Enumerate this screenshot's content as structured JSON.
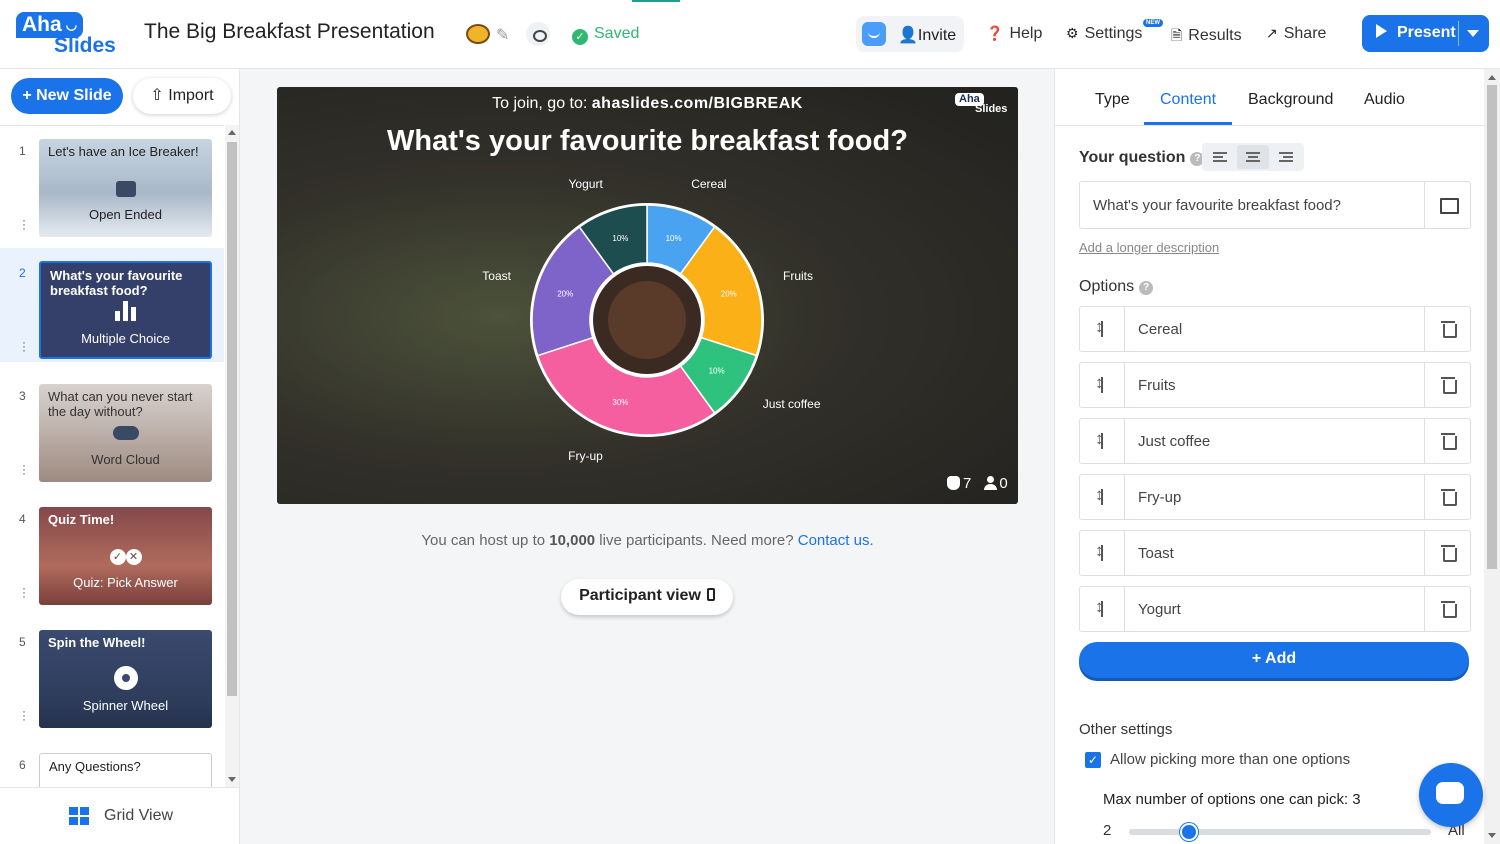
{
  "app": {
    "logo_top": "Aha",
    "logo_bottom": "Slides",
    "title": "The Big Breakfast Presentation",
    "status": "Saved"
  },
  "topnav": {
    "invite": "Invite",
    "help": "Help",
    "settings": "Settings",
    "settings_badge": "NEW",
    "results": "Results",
    "share": "Share",
    "present": "Present"
  },
  "sidebar": {
    "new_slide": "+ New Slide",
    "import": "Import",
    "grid_view": "Grid View",
    "slides": [
      {
        "num": "1",
        "title": "Let's have an Ice Breaker!",
        "type": "Open Ended"
      },
      {
        "num": "2",
        "title": "What's your favourite breakfast food?",
        "type": "Multiple Choice"
      },
      {
        "num": "3",
        "title": "What can you never start the day without?",
        "type": "Word Cloud"
      },
      {
        "num": "4",
        "title": "Quiz Time!",
        "type": "Quiz: Pick Answer"
      },
      {
        "num": "5",
        "title": "Spin the Wheel!",
        "type": "Spinner Wheel"
      },
      {
        "num": "6",
        "title": "Any Questions?",
        "type": ""
      }
    ]
  },
  "stage": {
    "join_prefix": "To join, go to: ",
    "join_url": "ahaslides.com/BIGBREAK",
    "mini_logo_top": "Aha",
    "mini_logo_bottom": "Slides",
    "question": "What's your favourite breakfast food?",
    "responses": "7",
    "participants": "0"
  },
  "chart_data": {
    "type": "pie",
    "categories": [
      "Cereal",
      "Fruits",
      "Just coffee",
      "Fry-up",
      "Toast",
      "Yogurt"
    ],
    "values": [
      10,
      20,
      10,
      30,
      20,
      10
    ],
    "value_labels": [
      "10%",
      "20%",
      "10%",
      "30%",
      "20%",
      "10%"
    ],
    "colors": [
      "#4aa3f0",
      "#fbb017",
      "#2ec27e",
      "#f55fa0",
      "#7e63c9",
      "#1d4d4f"
    ]
  },
  "hostinfo": {
    "prefix": "You can host up to ",
    "count": "10,000",
    "middle": " live participants. Need more? ",
    "link": "Contact us."
  },
  "participant_view": "Participant view",
  "panel": {
    "tabs": [
      "Type",
      "Content",
      "Background",
      "Audio"
    ],
    "active_tab": "Content",
    "question_label": "Your question",
    "question_value": "What's your favourite breakfast food?",
    "long_desc_link": "Add a longer description",
    "options_label": "Options",
    "options": [
      "Cereal",
      "Fruits",
      "Just coffee",
      "Fry-up",
      "Toast",
      "Yogurt"
    ],
    "add_label": "+ Add",
    "other_settings": "Other settings",
    "allow_multi": "Allow picking more than one options",
    "allow_multi_checked": true,
    "max_label": "Max number of options one can pick: 3",
    "slider_min": "2",
    "slider_max": "All",
    "slider_value": 3
  }
}
